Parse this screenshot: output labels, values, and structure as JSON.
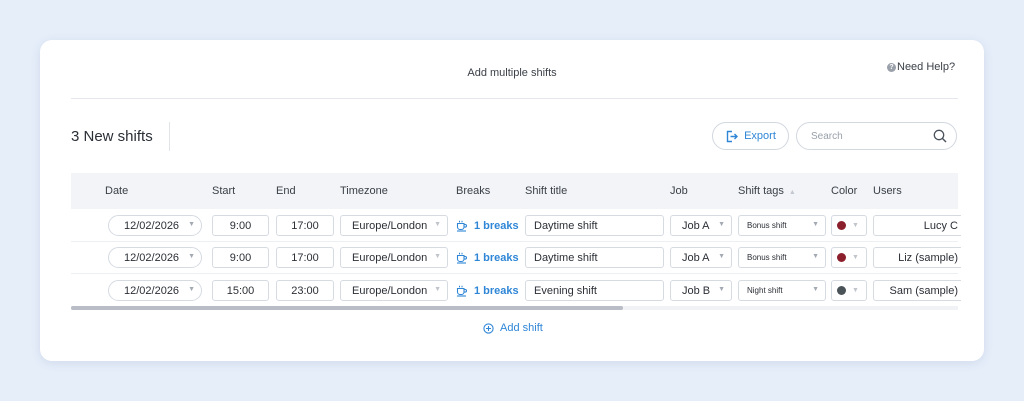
{
  "modal": {
    "title": "Add multiple shifts",
    "help_label": "Need Help?",
    "help_icon": "?"
  },
  "toolbar": {
    "count_label": "3 New shifts",
    "export_label": "Export",
    "search_placeholder": "Search"
  },
  "table": {
    "headers": {
      "date": "Date",
      "start": "Start",
      "end": "End",
      "timezone": "Timezone",
      "breaks": "Breaks",
      "shift_title": "Shift title",
      "job": "Job",
      "shift_tags": "Shift tags",
      "color": "Color",
      "users": "Users"
    },
    "rows": [
      {
        "date": "12/02/2026",
        "start": "9:00",
        "end": "17:00",
        "timezone": "Europe/London",
        "breaks": "1 breaks",
        "shift_title": "Daytime shift",
        "job": "Job A",
        "shift_tag": "Bonus shift",
        "color": "#8b1f2b",
        "user": "Lucy C"
      },
      {
        "date": "12/02/2026",
        "start": "9:00",
        "end": "17:00",
        "timezone": "Europe/London",
        "breaks": "1 breaks",
        "shift_title": "Daytime shift",
        "job": "Job A",
        "shift_tag": "Bonus shift",
        "color": "#8b1f2b",
        "user": "Liz (sample)"
      },
      {
        "date": "12/02/2026",
        "start": "15:00",
        "end": "23:00",
        "timezone": "Europe/London",
        "breaks": "1 breaks",
        "shift_title": "Evening shift",
        "job": "Job B",
        "shift_tag": "Night shift",
        "color": "#4a5357",
        "user": "Sam (sample)"
      }
    ]
  },
  "footer": {
    "add_shift_label": "Add shift"
  },
  "colors": {
    "accent": "#2f86d6",
    "page_background": "#e6eefa",
    "header_row": "#f2f4f7"
  },
  "icons": {
    "help": "help-circle-icon",
    "export": "export-icon",
    "search": "search-icon",
    "breaks": "coffee-break-icon",
    "add": "plus-circle-icon",
    "caret": "caret-down-icon"
  }
}
